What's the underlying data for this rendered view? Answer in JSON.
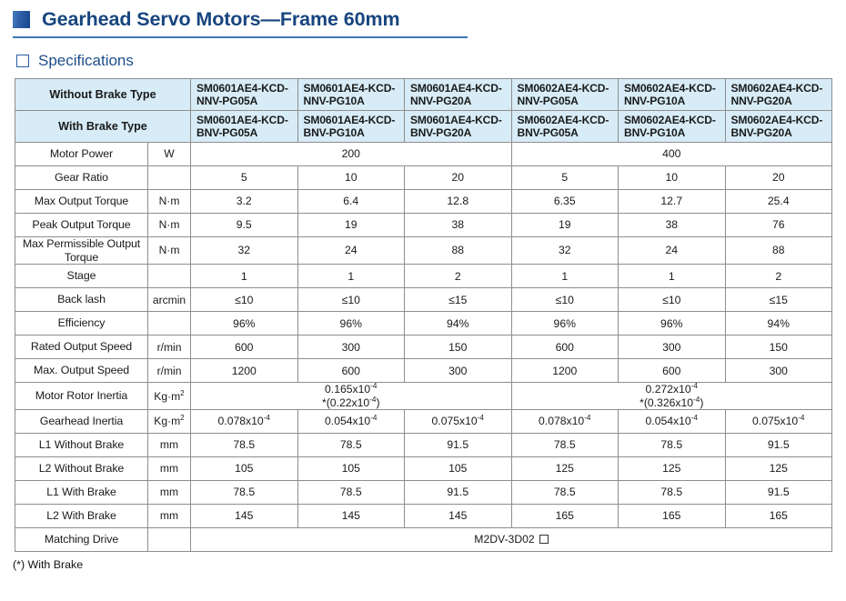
{
  "header": {
    "title": "Gearhead Servo Motors—Frame 60mm",
    "marker_icon": "blue-square-marker"
  },
  "section": {
    "label": "Specifications",
    "box_icon": "empty-square-icon"
  },
  "table": {
    "header_rows": [
      {
        "label": "Without Brake Type",
        "parts": [
          "SM0601AE4-KCD-NNV-PG05A",
          "SM0601AE4-KCD-NNV-PG10A",
          "SM0601AE4-KCD-NNV-PG20A",
          "SM0602AE4-KCD-NNV-PG05A",
          "SM0602AE4-KCD-NNV-PG10A",
          "SM0602AE4-KCD-NNV-PG20A"
        ]
      },
      {
        "label": "With Brake Type",
        "parts": [
          "SM0601AE4-KCD-BNV-PG05A",
          "SM0601AE4-KCD-BNV-PG10A",
          "SM0601AE4-KCD-BNV-PG20A",
          "SM0602AE4-KCD-BNV-PG05A",
          "SM0602AE4-KCD-BNV-PG10A",
          "SM0602AE4-KCD-BNV-PG20A"
        ]
      }
    ],
    "rows": [
      {
        "label": "Motor Power",
        "unit": "W",
        "span_left": "200",
        "span_right": "400"
      },
      {
        "label": "Gear Ratio",
        "unit": "",
        "values": [
          "5",
          "10",
          "20",
          "5",
          "10",
          "20"
        ]
      },
      {
        "label": "Max Output Torque",
        "unit": "N·m",
        "values": [
          "3.2",
          "6.4",
          "12.8",
          "6.35",
          "12.7",
          "25.4"
        ]
      },
      {
        "label": "Peak Output Torque",
        "unit": "N·m",
        "values": [
          "9.5",
          "19",
          "38",
          "19",
          "38",
          "76"
        ]
      },
      {
        "label": "Max Permissible Output Torque",
        "unit": "N·m",
        "values": [
          "32",
          "24",
          "88",
          "32",
          "24",
          "88"
        ]
      },
      {
        "label": "Stage",
        "unit": "",
        "values": [
          "1",
          "1",
          "2",
          "1",
          "1",
          "2"
        ]
      },
      {
        "label": "Back lash",
        "unit": "arcmin",
        "values": [
          "≤10",
          "≤10",
          "≤15",
          "≤10",
          "≤10",
          "≤15"
        ]
      },
      {
        "label": "Efficiency",
        "unit": "",
        "values": [
          "96%",
          "96%",
          "94%",
          "96%",
          "96%",
          "94%"
        ]
      },
      {
        "label": "Rated Output Speed",
        "unit": "r/min",
        "values": [
          "600",
          "300",
          "150",
          "600",
          "300",
          "150"
        ]
      },
      {
        "label": "Max. Output Speed",
        "unit": "r/min",
        "values": [
          "1200",
          "600",
          "300",
          "1200",
          "600",
          "300"
        ]
      }
    ],
    "inertia_row": {
      "label": "Motor Rotor Inertia",
      "unit_base": "Kg·m",
      "unit_sup": "2",
      "left": {
        "main_base": "0.165x10",
        "main_sup": "-4",
        "sub_base": "*(0.22x10",
        "sub_sup": "-4",
        "sub_tail": ")"
      },
      "right": {
        "main_base": "0.272x10",
        "main_sup": "-4",
        "sub_base": "*(0.326x10",
        "sub_sup": "-4",
        "sub_tail": ")"
      }
    },
    "gearhead_inertia_row": {
      "label": "Gearhead Inertia",
      "unit_base": "Kg·m",
      "unit_sup": "2",
      "values": [
        "0.078x10",
        "0.054x10",
        "0.075x10",
        "0.078x10",
        "0.054x10",
        "0.075x10"
      ],
      "sup": "-4"
    },
    "dim_rows": [
      {
        "label": "L1 Without Brake",
        "unit": "mm",
        "values": [
          "78.5",
          "78.5",
          "91.5",
          "78.5",
          "78.5",
          "91.5"
        ]
      },
      {
        "label": "L2 Without Brake",
        "unit": "mm",
        "values": [
          "105",
          "105",
          "105",
          "125",
          "125",
          "125"
        ]
      },
      {
        "label": "L1 With Brake",
        "unit": "mm",
        "values": [
          "78.5",
          "78.5",
          "91.5",
          "78.5",
          "78.5",
          "91.5"
        ]
      },
      {
        "label": "L2 With Brake",
        "unit": "mm",
        "values": [
          "145",
          "145",
          "145",
          "165",
          "165",
          "165"
        ]
      }
    ],
    "matching_drive": {
      "label": "Matching Drive",
      "unit": "",
      "value": "M2DV-3D02",
      "trailing_box_icon": "empty-square-icon"
    }
  },
  "footnote": "(*) With Brake",
  "colors": {
    "title_blue": "#17457f",
    "rule_blue": "#3f74b4",
    "header_fill": "#d7ecf7",
    "border_gray": "#8e8e8e"
  }
}
